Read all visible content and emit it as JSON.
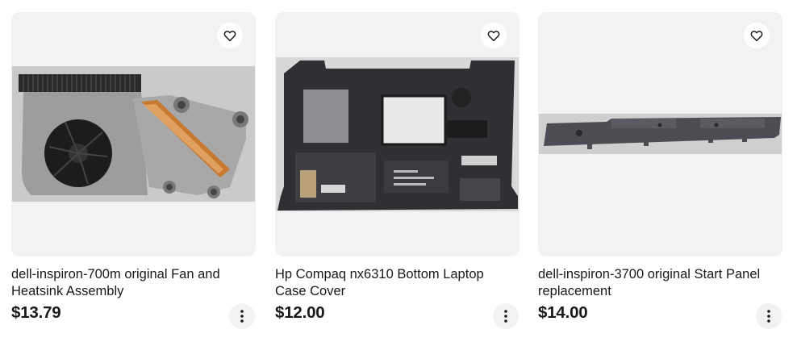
{
  "listings": [
    {
      "title": "dell-inspiron-700m original Fan and Heatsink Assembly",
      "price": "$13.79",
      "image": "laptop fan and heatsink assembly photo",
      "favorite_icon": "heart-outline-icon",
      "more_icon": "vertical-dots-icon"
    },
    {
      "title": "Hp Compaq nx6310 Bottom Laptop Case Cover",
      "price": "$12.00",
      "image": "black laptop bottom case cover photo",
      "favorite_icon": "heart-outline-icon",
      "more_icon": "vertical-dots-icon"
    },
    {
      "title": "dell-inspiron-3700 original Start Panel replacement",
      "price": "$14.00",
      "image": "long dark grey hinge start panel photo",
      "favorite_icon": "heart-outline-icon",
      "more_icon": "vertical-dots-icon"
    }
  ],
  "colors": {
    "image_background": "#f2f2f2",
    "text": "#191919",
    "button_background": "#f2f2f2"
  }
}
